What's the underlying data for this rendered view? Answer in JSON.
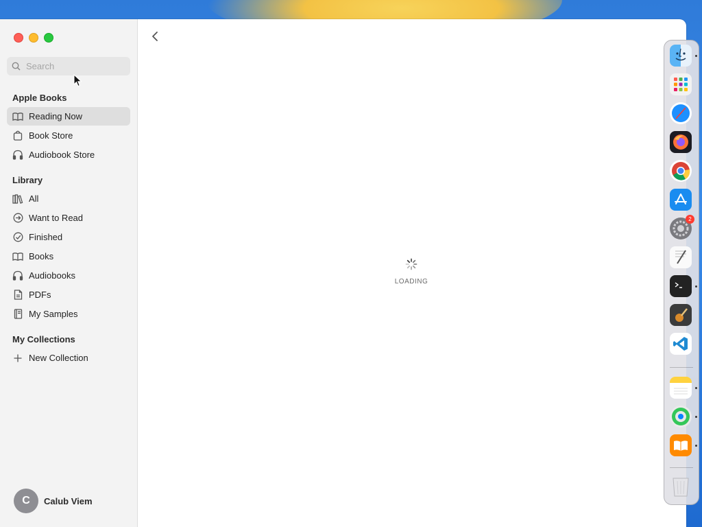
{
  "window": {
    "search": {
      "placeholder": "Search",
      "value": ""
    },
    "sections": {
      "apple_books": "Apple Books",
      "library": "Library",
      "my_collections": "My Collections"
    },
    "apple_books_items": [
      {
        "label": "Reading Now",
        "icon": "book-open-icon",
        "active": true
      },
      {
        "label": "Book Store",
        "icon": "shopping-bag-icon",
        "active": false
      },
      {
        "label": "Audiobook Store",
        "icon": "headphones-icon",
        "active": false
      }
    ],
    "library_items": [
      {
        "label": "All",
        "icon": "books-shelf-icon"
      },
      {
        "label": "Want to Read",
        "icon": "arrow-circle-icon"
      },
      {
        "label": "Finished",
        "icon": "checkmark-circle-icon"
      },
      {
        "label": "Books",
        "icon": "book-open-icon"
      },
      {
        "label": "Audiobooks",
        "icon": "headphones-icon"
      },
      {
        "label": "PDFs",
        "icon": "document-icon"
      },
      {
        "label": "My Samples",
        "icon": "sample-book-icon"
      }
    ],
    "collections_items": [
      {
        "label": "New Collection",
        "icon": "plus-icon"
      }
    ],
    "profile": {
      "initial": "C",
      "name": "Calub Viem"
    },
    "main": {
      "loading_label": "LOADING"
    }
  },
  "dock": {
    "apps": [
      {
        "name": "finder-icon",
        "running": true
      },
      {
        "name": "launchpad-icon",
        "running": false
      },
      {
        "name": "safari-icon",
        "running": false
      },
      {
        "name": "firefox-icon",
        "running": false
      },
      {
        "name": "chrome-icon",
        "running": false
      },
      {
        "name": "app-store-icon",
        "running": false
      },
      {
        "name": "system-settings-icon",
        "running": false,
        "badge": "2"
      },
      {
        "name": "textedit-icon",
        "running": false
      },
      {
        "name": "terminal-icon",
        "running": true
      },
      {
        "name": "garageband-icon",
        "running": false
      },
      {
        "name": "vscode-icon",
        "running": false
      },
      {
        "name": "notes-icon",
        "running": true
      },
      {
        "name": "find-my-icon",
        "running": true
      },
      {
        "name": "books-icon",
        "running": true
      },
      {
        "name": "trash-icon",
        "running": false
      }
    ]
  }
}
